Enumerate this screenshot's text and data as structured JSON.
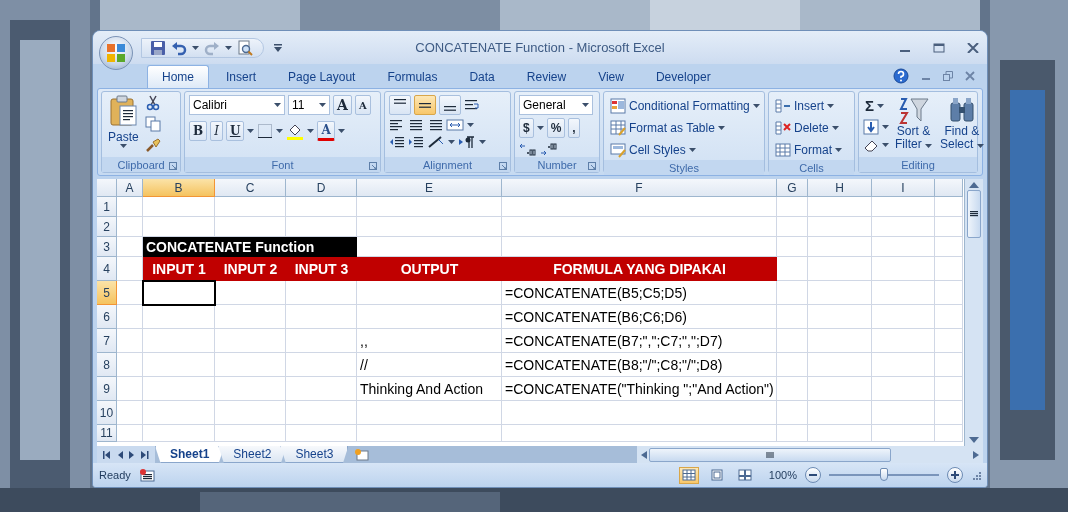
{
  "window": {
    "title": "CONCATENATE Function - Microsoft Excel"
  },
  "ribbon_tabs": [
    {
      "label": "Home",
      "selected": true
    },
    {
      "label": "Insert",
      "selected": false
    },
    {
      "label": "Page Layout",
      "selected": false
    },
    {
      "label": "Formulas",
      "selected": false
    },
    {
      "label": "Data",
      "selected": false
    },
    {
      "label": "Review",
      "selected": false
    },
    {
      "label": "View",
      "selected": false
    },
    {
      "label": "Developer",
      "selected": false
    }
  ],
  "clipboard": {
    "label": "Clipboard",
    "paste": "Paste"
  },
  "font": {
    "label": "Font",
    "name": "Calibri",
    "size": "11",
    "grow": "A",
    "shrink": "A",
    "styles": [
      "B",
      "I",
      "U"
    ],
    "color_letter": "A"
  },
  "alignment": {
    "label": "Alignment",
    "vertical": [
      {
        "selected": false
      },
      {
        "selected": true
      },
      {
        "selected": false
      }
    ]
  },
  "number": {
    "label": "Number",
    "format": "General",
    "symbols": [
      "$",
      "%",
      ","
    ]
  },
  "styles": {
    "label": "Styles",
    "items": [
      "Conditional Formatting",
      "Format as Table",
      "Cell Styles"
    ]
  },
  "cells": {
    "label": "Cells",
    "items": [
      "Insert",
      "Delete",
      "Format"
    ]
  },
  "editing": {
    "label": "Editing",
    "sum": "Σ",
    "sort": [
      "Sort &",
      "Filter"
    ],
    "find": [
      "Find &",
      "Select"
    ]
  },
  "columns": [
    {
      "label": "A",
      "selected": false
    },
    {
      "label": "B",
      "selected": true
    },
    {
      "label": "C",
      "selected": false
    },
    {
      "label": "D",
      "selected": false
    },
    {
      "label": "E",
      "selected": false
    },
    {
      "label": "F",
      "selected": false
    },
    {
      "label": "G",
      "selected": false
    },
    {
      "label": "H",
      "selected": false
    },
    {
      "label": "I",
      "selected": false
    }
  ],
  "rows": [
    {
      "number": "1",
      "selected": false
    },
    {
      "number": "2",
      "selected": false
    },
    {
      "number": "3",
      "selected": false,
      "title": "CONCATENATE Function"
    },
    {
      "number": "4",
      "selected": false,
      "headings": [
        "INPUT 1",
        "INPUT 2",
        "INPUT 3",
        "OUTPUT",
        "FORMULA YANG DIPAKAI"
      ]
    },
    {
      "number": "5",
      "selected": true,
      "formula": "=CONCATENATE(B5;C5;D5)"
    },
    {
      "number": "6",
      "selected": false,
      "formula": "=CONCATENATE(B6;C6;D6)"
    },
    {
      "number": "7",
      "selected": false,
      "output": ",,",
      "formula": "=CONCATENATE(B7;\",\";C7;\",\";D7)"
    },
    {
      "number": "8",
      "selected": false,
      "output": "//",
      "formula": "=CONCATENATE(B8;\"/\";C8;\"/\";D8)"
    },
    {
      "number": "9",
      "selected": false,
      "output": "Thinking And Action",
      "formula": "=CONCATENATE(\"Thinking \";\"And Action\")"
    },
    {
      "number": "10",
      "selected": false
    },
    {
      "number": "11",
      "selected": false
    }
  ],
  "sheet_tabs": [
    {
      "label": "Sheet1",
      "selected": true
    },
    {
      "label": "Sheet2",
      "selected": false
    },
    {
      "label": "Sheet3",
      "selected": false
    }
  ],
  "status_bar": {
    "text": "Ready",
    "views": [
      {
        "selected": true
      },
      {
        "selected": false
      },
      {
        "selected": false
      }
    ],
    "zoom": "100%",
    "level": 0.5
  }
}
